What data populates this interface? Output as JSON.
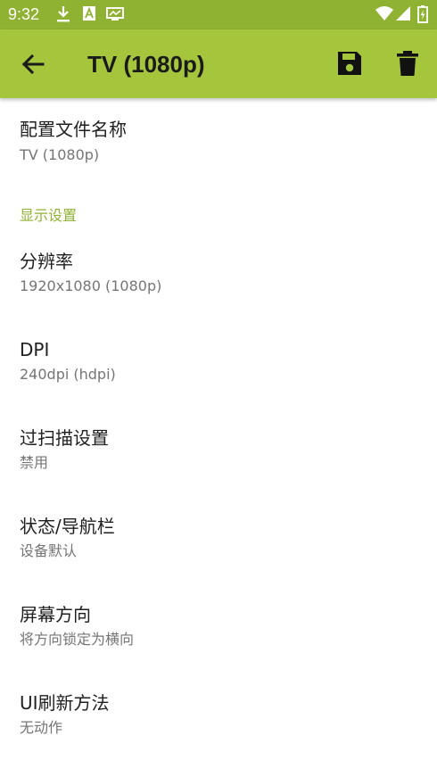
{
  "status_bar": {
    "time": "9:32"
  },
  "app_bar": {
    "title": "TV (1080p)"
  },
  "profile": {
    "title": "配置文件名称",
    "summary": "TV (1080p)"
  },
  "category": "显示设置",
  "items": [
    {
      "title": "分辨率",
      "summary": "1920x1080 (1080p)"
    },
    {
      "title": "DPI",
      "summary": "240dpi (hdpi)"
    },
    {
      "title": "过扫描设置",
      "summary": "禁用"
    },
    {
      "title": "状态/导航栏",
      "summary": "设备默认"
    },
    {
      "title": "屏幕方向",
      "summary": "将方向锁定为横向"
    },
    {
      "title": "UI刷新方法",
      "summary": "无动作"
    }
  ],
  "colors": {
    "status_bar": "#8fb233",
    "app_bar": "#a5c63c",
    "accent": "#8fb233"
  }
}
